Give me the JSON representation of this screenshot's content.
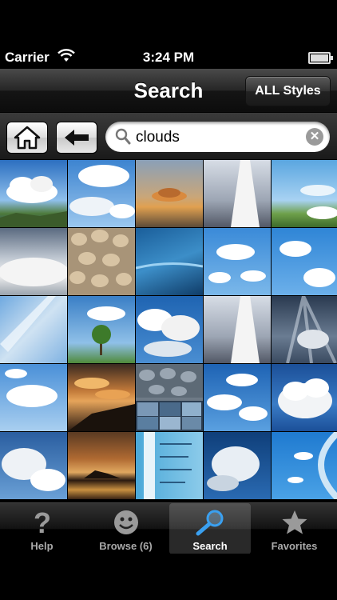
{
  "status": {
    "carrier": "Carrier",
    "time": "3:24 PM"
  },
  "nav": {
    "title": "Search",
    "styles_button": "ALL Styles"
  },
  "search": {
    "query": "clouds",
    "clear": "✕"
  },
  "tabs": [
    {
      "label": "Help",
      "icon": "question-icon"
    },
    {
      "label": "Browse (6)",
      "icon": "smiley-icon"
    },
    {
      "label": "Search",
      "icon": "magnifier-icon"
    },
    {
      "label": "Favorites",
      "icon": "star-icon"
    }
  ],
  "active_tab": "Search",
  "grid": {
    "rows": 5,
    "cols": 5,
    "thumbnails": [
      "cumulus over coast",
      "cumulus clouds",
      "lenticular sunset",
      "contrail",
      "lenticular over field",
      "stratocumulus",
      "mammatus",
      "ocean horizon",
      "cumulus",
      "cumulus",
      "cirrus streaks",
      "cloud over tree",
      "cumulus",
      "contrail",
      "crepuscular rays",
      "cumulus",
      "mammatus sunset",
      "cloud chart",
      "cumulus",
      "cumulonimbus",
      "sunlit clouds",
      "sunset over lake",
      "cloud diagram",
      "towering clouds",
      "cirrus"
    ]
  },
  "colors": {
    "sky_blue": "#3e86c9",
    "nav_dark": "#1a1a1a"
  }
}
